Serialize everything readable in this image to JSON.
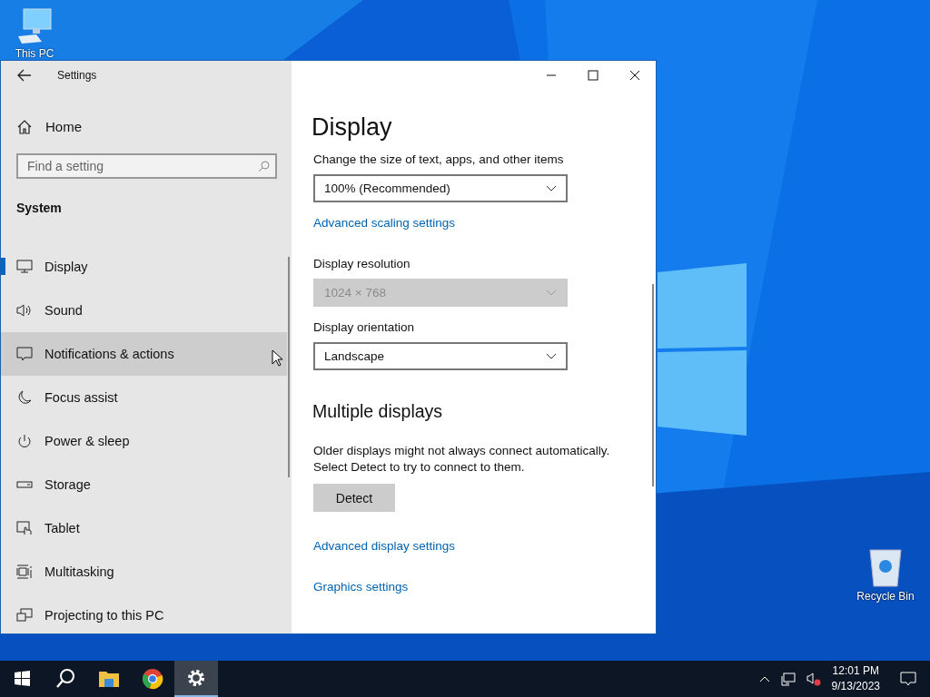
{
  "desktop": {
    "icons": [
      {
        "label": "This PC"
      },
      {
        "label": "Recycle Bin"
      }
    ]
  },
  "window": {
    "title": "Settings",
    "sidebar": {
      "home": "Home",
      "search": {
        "placeholder": "Find a setting"
      },
      "section": "System",
      "items": [
        {
          "label": "Display",
          "selected": true,
          "hovered": false
        },
        {
          "label": "Sound",
          "selected": false,
          "hovered": false
        },
        {
          "label": "Notifications & actions",
          "selected": false,
          "hovered": true
        },
        {
          "label": "Focus assist",
          "selected": false,
          "hovered": false
        },
        {
          "label": "Power & sleep",
          "selected": false,
          "hovered": false
        },
        {
          "label": "Storage",
          "selected": false,
          "hovered": false
        },
        {
          "label": "Tablet",
          "selected": false,
          "hovered": false
        },
        {
          "label": "Multitasking",
          "selected": false,
          "hovered": false
        },
        {
          "label": "Projecting to this PC",
          "selected": false,
          "hovered": false
        }
      ]
    },
    "content": {
      "title": "Display",
      "settings": [
        {
          "kind": "label",
          "text": "Change the size of text, apps, and other items"
        },
        {
          "kind": "dropdown",
          "value": "100% (Recommended)",
          "disabled": false
        },
        {
          "kind": "link",
          "text": "Advanced scaling settings"
        },
        {
          "kind": "label",
          "text": "Display resolution"
        },
        {
          "kind": "dropdown",
          "value": "1024 × 768",
          "disabled": true
        },
        {
          "kind": "label",
          "text": "Display orientation"
        },
        {
          "kind": "dropdown",
          "value": "Landscape",
          "disabled": false
        },
        {
          "kind": "heading",
          "text": "Multiple displays"
        },
        {
          "kind": "paragraph",
          "text": "Older displays might not always connect automatically. Select Detect to try to connect to them."
        },
        {
          "kind": "button",
          "text": "Detect"
        },
        {
          "kind": "link",
          "text": "Advanced display settings"
        },
        {
          "kind": "link",
          "text": "Graphics settings"
        }
      ]
    }
  },
  "taskbar": {
    "apps": [
      {
        "kind": "folder",
        "selected": false
      },
      {
        "kind": "browser",
        "selected": false
      },
      {
        "kind": "settings",
        "selected": true
      }
    ],
    "time": "12:01 PM",
    "date": "9/13/2023"
  }
}
